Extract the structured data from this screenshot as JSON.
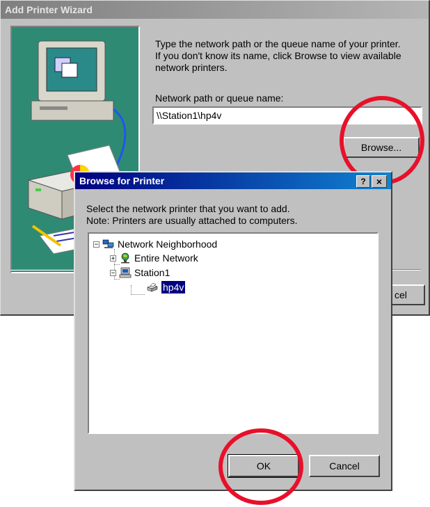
{
  "wizard": {
    "title": "Add Printer Wizard",
    "instructions": [
      "Type the network path or the queue name of your printer.",
      "If you don't know its name, click Browse to view available",
      "network printers."
    ],
    "path_label": "Network path or queue name:",
    "path_value": "\\\\Station1\\hp4v",
    "browse_label": "Browse...",
    "cancel_label": "cel"
  },
  "browse_dialog": {
    "title": "Browse for Printer",
    "help_label": "?",
    "close_label": "×",
    "instructions": [
      "Select the network printer that you want to add.",
      "Note: Printers are usually attached to computers."
    ],
    "tree": {
      "root": "Network Neighborhood",
      "entire_network": "Entire Network",
      "station": "Station1",
      "printer": "hp4v",
      "collapse_glyph": "−",
      "expand_glyph": "+"
    },
    "ok_label": "OK",
    "cancel_label": "Cancel"
  },
  "colors": {
    "highlight": "#e8102a",
    "wizard_panel": "#2f8a74",
    "selection": "#000080"
  }
}
